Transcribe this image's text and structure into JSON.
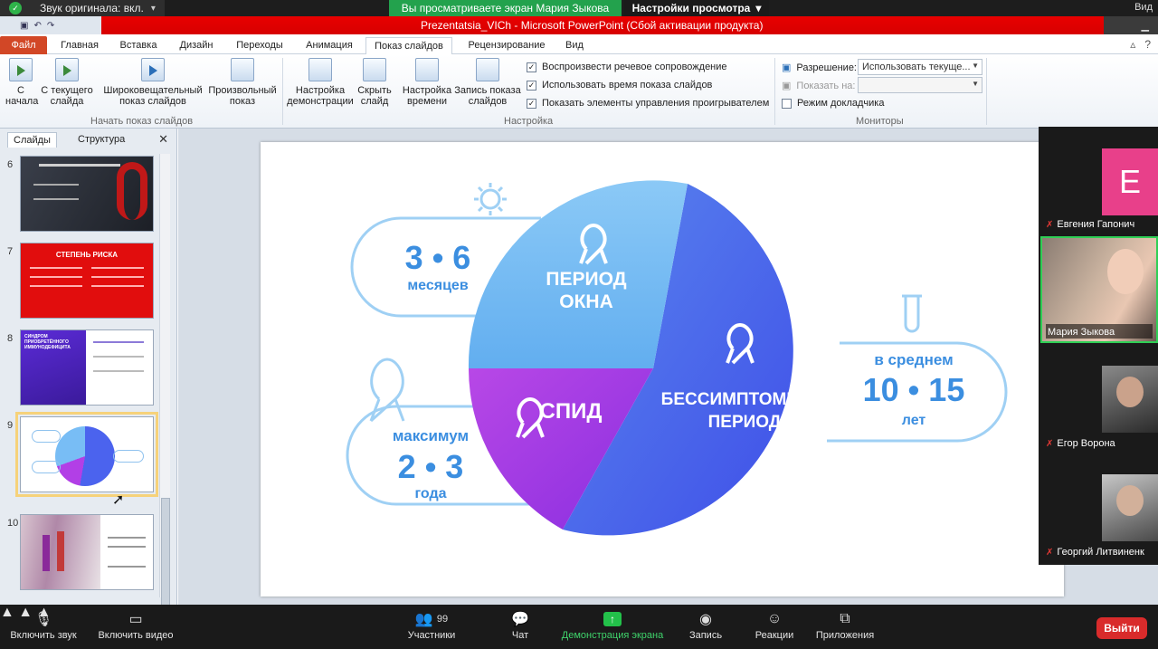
{
  "zoom_top": {
    "original_sound": "Звук оригинала: вкл.",
    "viewing_banner": "Вы просматриваете экран Мария Зыкова",
    "view_settings": "Настройки просмотра",
    "view_right": "Вид"
  },
  "ppt": {
    "window_title": "Prezentatsia_VICh  -  Microsoft PowerPoint (Сбой активации продукта)",
    "tabs": [
      "Файл",
      "Главная",
      "Вставка",
      "Дизайн",
      "Переходы",
      "Анимация",
      "Показ слайдов",
      "Рецензирование",
      "Вид"
    ],
    "active_tab": "Показ слайдов",
    "ribbon": {
      "start_from_beginning": "С начала",
      "from_current": "С текущего слайда",
      "broadcast": "Широковещательный показ слайдов",
      "custom_show": "Произвольный показ",
      "group_start": "Начать показ слайдов",
      "setup_show": "Настройка демонстрации",
      "hide_slide": "Скрыть слайд",
      "rehearse": "Настройка времени",
      "record": "Запись показа слайдов",
      "play_narrations": "Воспроизвести речевое сопровождение",
      "use_timings": "Использовать время показа слайдов",
      "show_controls": "Показать элементы управления проигрывателем",
      "group_setup": "Настройка",
      "resolution_label": "Разрешение:",
      "resolution_value": "Использовать текуще...",
      "show_on_label": "Показать на:",
      "presenter_view": "Режим докладчика",
      "group_monitors": "Мониторы"
    },
    "pane": {
      "tab_slides": "Слайды",
      "tab_outline": "Структура",
      "close": "✕",
      "thumbs": [
        {
          "num": "6"
        },
        {
          "num": "7",
          "title": "СТЕПЕНЬ РИСКА"
        },
        {
          "num": "8",
          "title": "СИНДРОМ ПРИОБРЕТЁННОГО ИММУНОДЕФИЦИТА"
        },
        {
          "num": "9"
        },
        {
          "num": "10"
        }
      ]
    }
  },
  "slide": {
    "window_months": "3 • 6",
    "window_unit": "месяцев",
    "window_title_1": "ПЕРИОД",
    "window_title_2": "ОКНА",
    "aids_title": "СПИД",
    "latent_title_1": "БЕССИМПТОМНЫЙ",
    "latent_title_2": "ПЕРИОД",
    "avg_label": "в среднем",
    "avg_years": "10 • 15",
    "avg_unit": "лет",
    "max_label": "максимум",
    "max_years": "2 • 3",
    "max_unit": "года",
    "colors": {
      "blue_light": "#6cb8f2",
      "blue_dark": "#3f5be8",
      "purple": "#a03be0",
      "accent": "#3b8ee0"
    }
  },
  "participants": [
    {
      "name": "Евгения Гапонич",
      "initial": "E",
      "muted": true
    },
    {
      "name": "Мария Зыкова",
      "muted": false
    },
    {
      "name": "Егор Ворона",
      "muted": true
    },
    {
      "name": "Георгий Литвиненк",
      "muted": true
    }
  ],
  "zoom_toolbar": {
    "unmute": "Включить звук",
    "start_video": "Включить видео",
    "participants_count": "99",
    "participants": "Участники",
    "chat": "Чат",
    "share": "Демонстрация экрана",
    "record": "Запись",
    "reactions": "Реакции",
    "apps": "Приложения",
    "leave": "Выйти"
  }
}
